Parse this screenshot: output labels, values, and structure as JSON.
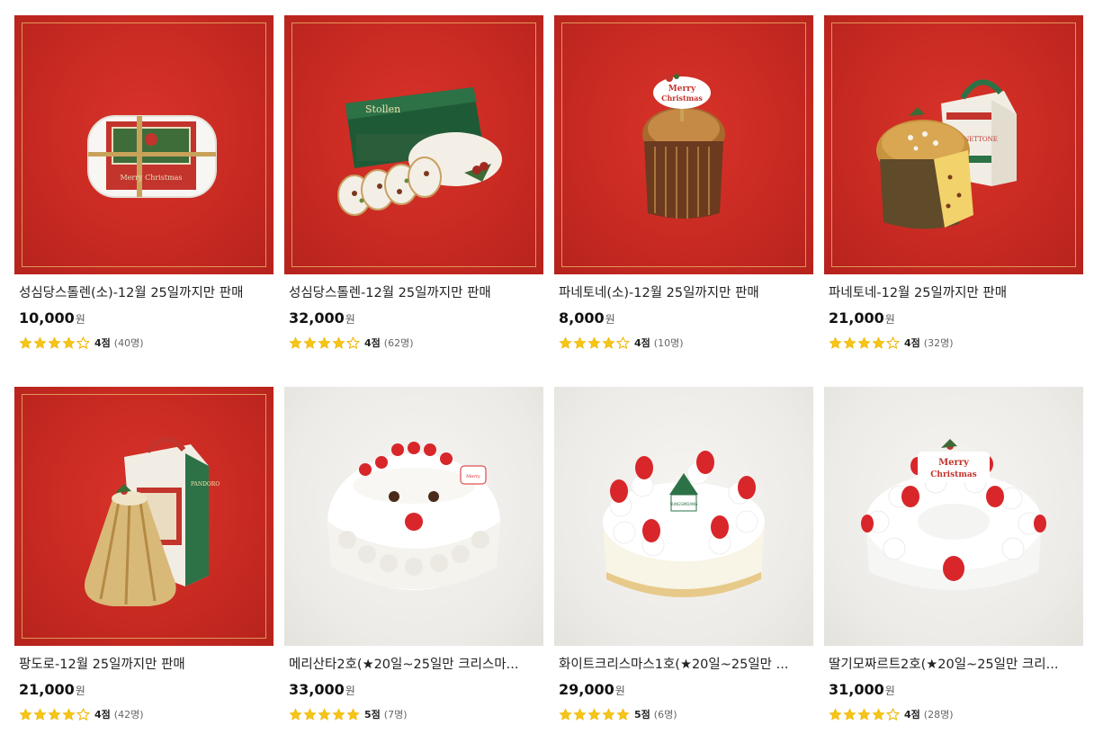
{
  "products": [
    {
      "name": "성심당스톨렌(소)-12월 25일까지만 판매",
      "price": "10,000",
      "currency": "원",
      "rating": 4,
      "score_label": "4점",
      "count_label": "(40명)",
      "bg": "red",
      "image_icon": "stollen-small-icon"
    },
    {
      "name": "성심당스톨렌-12월 25일까지만 판매",
      "price": "32,000",
      "currency": "원",
      "rating": 4,
      "score_label": "4점",
      "count_label": "(62명)",
      "bg": "red",
      "image_icon": "stollen-sliced-icon"
    },
    {
      "name": "파네토네(소)-12월 25일까지만 판매",
      "price": "8,000",
      "currency": "원",
      "rating": 4,
      "score_label": "4점",
      "count_label": "(10명)",
      "bg": "red",
      "image_icon": "panettone-small-icon"
    },
    {
      "name": "파네토네-12월 25일까지만 판매",
      "price": "21,000",
      "currency": "원",
      "rating": 4,
      "score_label": "4점",
      "count_label": "(32명)",
      "bg": "red",
      "image_icon": "panettone-box-icon"
    },
    {
      "name": "팡도로-12월 25일까지만 판매",
      "price": "21,000",
      "currency": "원",
      "rating": 4,
      "score_label": "4점",
      "count_label": "(42명)",
      "bg": "red",
      "image_icon": "pandoro-icon"
    },
    {
      "name": "메리산타2호(★20일~25일만 크리스마...",
      "price": "33,000",
      "currency": "원",
      "rating": 5,
      "score_label": "5점",
      "count_label": "(7명)",
      "bg": "grey",
      "image_icon": "santa-cake-icon"
    },
    {
      "name": "화이트크리스마스1호(★20일~25일만 ...",
      "price": "29,000",
      "currency": "원",
      "rating": 5,
      "score_label": "5점",
      "count_label": "(6명)",
      "bg": "grey",
      "image_icon": "white-christmas-cake-icon"
    },
    {
      "name": "딸기모짜르트2호(★20일~25일만 크리...",
      "price": "31,000",
      "currency": "원",
      "rating": 4,
      "score_label": "4점",
      "count_label": "(28명)",
      "bg": "grey",
      "image_icon": "strawberry-mozart-cake-icon"
    }
  ],
  "images": {
    "stollen_label": "Merry Christmas",
    "stollen_box_label": "Stollen",
    "panettone_topper": [
      "Merry",
      "Christmas"
    ],
    "panettone_box_label": "PANETTONE",
    "pandoro_box_label": "PANDORO",
    "cake_brand": "SUNGSIMDANG",
    "merry_topper": [
      "Merry",
      "Christmas"
    ]
  },
  "colors": {
    "star": "#f5c518",
    "star_empty_stroke": "#f0b400",
    "red_bg": "#c82a22",
    "gold_frame": "#ebbe6e"
  }
}
